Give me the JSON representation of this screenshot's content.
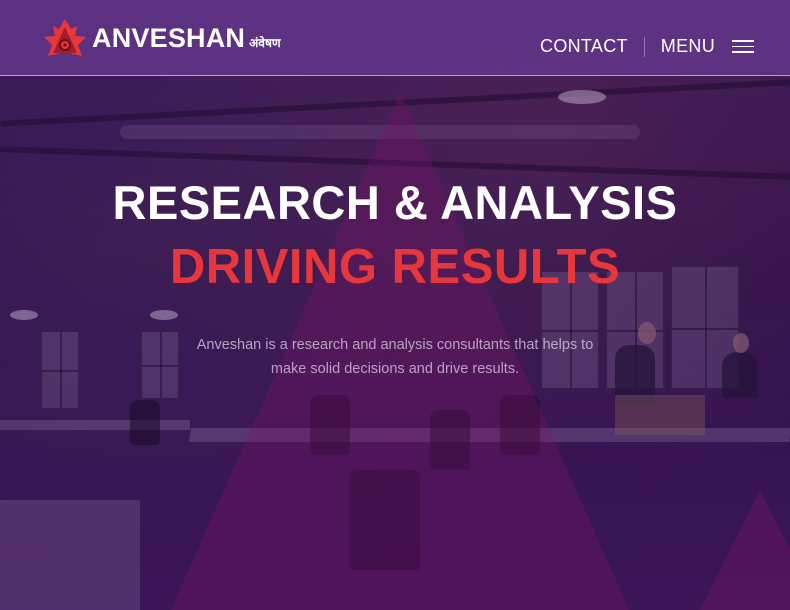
{
  "brand": {
    "name": "ANVESHAN",
    "name_native": "अंवेषण",
    "logo_icon": "maple-leaf-icon",
    "accent_color": "#e8373a"
  },
  "nav": {
    "contact_label": "CONTACT",
    "menu_label": "MENU",
    "menu_icon": "hamburger-icon"
  },
  "hero": {
    "headline": "RESEARCH & ANALYSIS",
    "subheadline": "DRIVING RESULTS",
    "description": "Anveshan is a research and analysis consultants that helps to make solid decisions and drive results."
  },
  "colors": {
    "header_bg": "#64378c",
    "overlay": "#3c145a",
    "text": "#ffffff"
  }
}
